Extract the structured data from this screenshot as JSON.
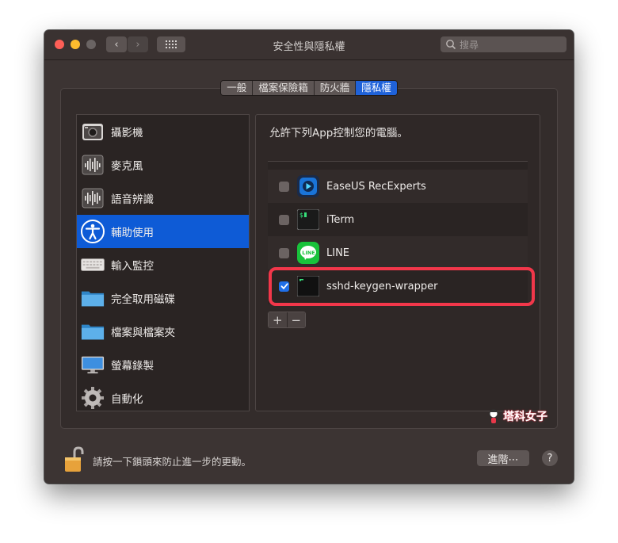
{
  "window": {
    "title": "安全性與隱私權"
  },
  "search": {
    "placeholder": "搜尋"
  },
  "tabs": [
    {
      "label": "一般",
      "active": false
    },
    {
      "label": "檔案保險箱",
      "active": false
    },
    {
      "label": "防火牆",
      "active": false
    },
    {
      "label": "隱私權",
      "active": true
    }
  ],
  "sidebar": {
    "items": [
      {
        "label": "攝影機",
        "icon": "camera-icon"
      },
      {
        "label": "麥克風",
        "icon": "microphone-icon"
      },
      {
        "label": "語音辨識",
        "icon": "speech-recognition-icon"
      },
      {
        "label": "輔助使用",
        "icon": "accessibility-icon",
        "selected": true
      },
      {
        "label": "輸入監控",
        "icon": "keyboard-icon"
      },
      {
        "label": "完全取用磁碟",
        "icon": "folder-icon"
      },
      {
        "label": "檔案與檔案夾",
        "icon": "folder-icon"
      },
      {
        "label": "螢幕錄製",
        "icon": "display-icon"
      },
      {
        "label": "自動化",
        "icon": "gear-icon"
      }
    ]
  },
  "main": {
    "heading": "允許下列App控制您的電腦。",
    "apps": [
      {
        "name": "EaseUS RecExperts",
        "checked": false,
        "icon": "easeus-icon"
      },
      {
        "name": "iTerm",
        "checked": false,
        "icon": "terminal-icon"
      },
      {
        "name": "LINE",
        "checked": false,
        "icon": "line-icon"
      },
      {
        "name": "sshd-keygen-wrapper",
        "checked": true,
        "icon": "terminal-icon"
      }
    ],
    "add_label": "+",
    "remove_label": "−"
  },
  "footer": {
    "lock_text": "請按一下鎖頭來防止進一步的更動。",
    "advanced_label": "進階⋯",
    "help_label": "?"
  },
  "watermark": {
    "text": "塔科女子"
  },
  "colors": {
    "accent": "#0e5bd6",
    "highlight": "#f2374a"
  }
}
